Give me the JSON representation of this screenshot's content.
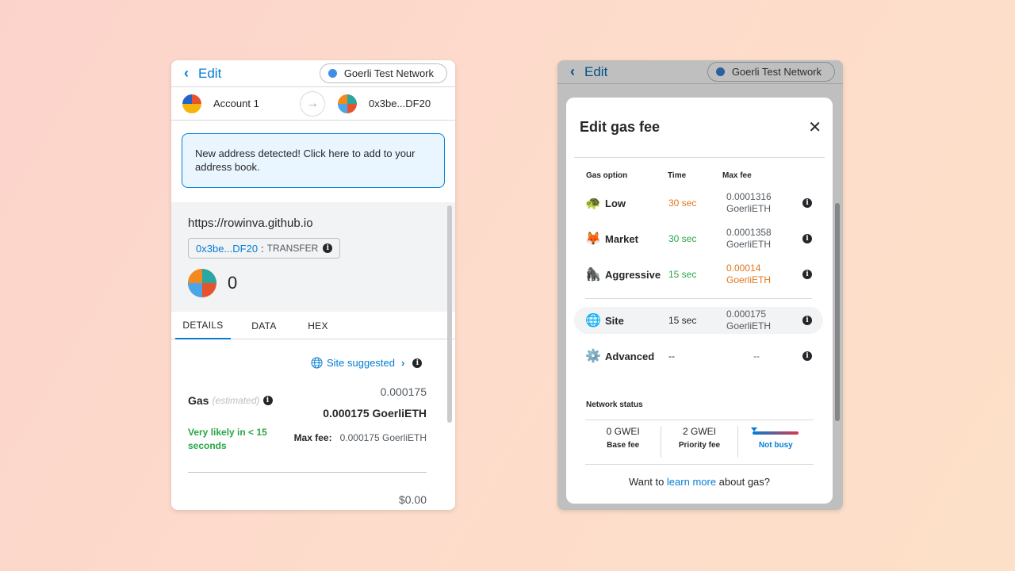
{
  "left": {
    "header": {
      "back_label": "Edit",
      "network": "Goerli Test Network"
    },
    "accounts": {
      "from": "Account 1",
      "to": "0x3be...DF20"
    },
    "banner": "New address detected! Click here to add to your address book.",
    "origin": "https://rowinva.github.io",
    "method": {
      "address": "0x3be...DF20",
      "separator": ":",
      "name": "TRANSFER"
    },
    "amount": "0",
    "tabs": [
      "DETAILS",
      "DATA",
      "HEX"
    ],
    "site_suggested": "Site suggested",
    "gas": {
      "label": "Gas",
      "estimated": "(estimated)",
      "value": "0.000175",
      "value_bold": "0.000175 GoerliETH",
      "likely": "Very likely in < 15 seconds",
      "max_fee_label": "Max fee:",
      "max_fee_value": "0.000175 GoerliETH"
    },
    "total": "$0.00"
  },
  "right": {
    "header": {
      "back_label": "Edit",
      "network": "Goerli Test Network"
    },
    "modal": {
      "title": "Edit gas fee",
      "columns": {
        "option": "Gas option",
        "time": "Time",
        "max_fee": "Max fee"
      },
      "options": [
        {
          "emoji": "🐢",
          "name": "Low",
          "time": "30 sec",
          "fee_amount": "0.0001316",
          "fee_unit": "GoerliETH"
        },
        {
          "emoji": "🦊",
          "name": "Market",
          "time": "30 sec",
          "fee_amount": "0.0001358",
          "fee_unit": "GoerliETH"
        },
        {
          "emoji": "🦍",
          "name": "Aggressive",
          "time": "15 sec",
          "fee_amount": "0.00014",
          "fee_unit": "GoerliETH"
        },
        {
          "emoji": "🌐",
          "name": "Site",
          "time": "15 sec",
          "fee_amount": "0.000175",
          "fee_unit": "GoerliETH"
        },
        {
          "emoji": "⚙️",
          "name": "Advanced",
          "time": "--",
          "fee_amount": "--",
          "fee_unit": ""
        }
      ],
      "network_status": {
        "label": "Network status",
        "base_fee_value": "0 GWEI",
        "base_fee_label": "Base fee",
        "priority_fee_value": "2 GWEI",
        "priority_fee_label": "Priority fee",
        "busy_label": "Not busy"
      },
      "learn": {
        "prefix": "Want to ",
        "link": "learn more",
        "suffix": " about gas?"
      }
    }
  },
  "colors": {
    "accent": "#037dd6",
    "success": "#28a745",
    "warning": "#e2761b"
  }
}
